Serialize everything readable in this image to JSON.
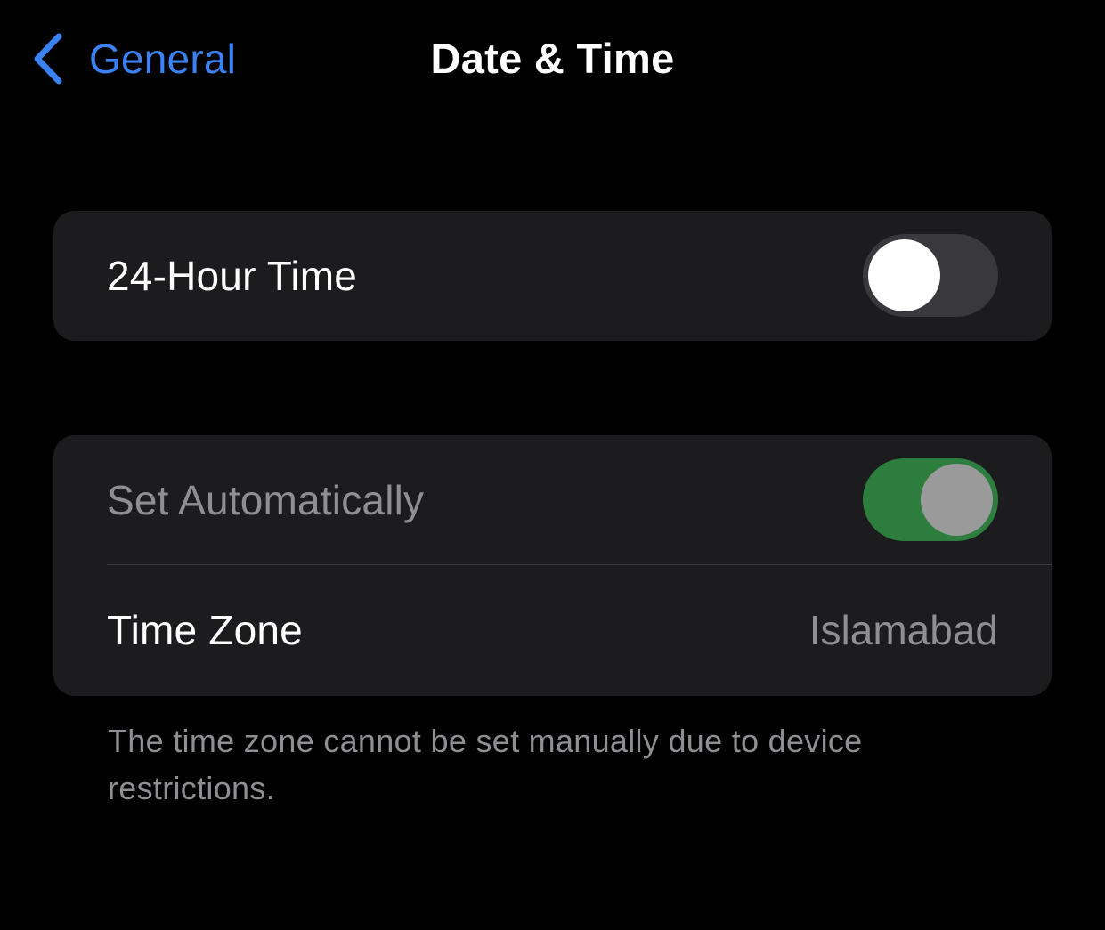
{
  "nav": {
    "back_label": "General",
    "title": "Date & Time",
    "accent_color": "#3b82f6",
    "back_icon": "chevron-left-icon"
  },
  "settings": {
    "hour24": {
      "label": "24-Hour Time",
      "enabled": false
    },
    "set_automatically": {
      "label": "Set Automatically",
      "enabled": true,
      "disabled": true,
      "on_color": "#2d7d3e"
    },
    "time_zone": {
      "label": "Time Zone",
      "value": "Islamabad"
    }
  },
  "footer_note": "The time zone cannot be set manually due to device restrictions."
}
